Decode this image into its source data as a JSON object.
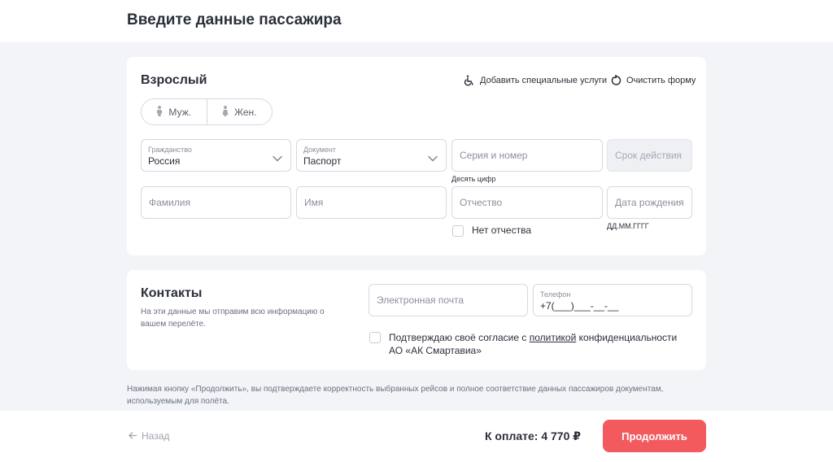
{
  "page": {
    "title": "Введите данные пассажира"
  },
  "adult": {
    "title": "Взрослый",
    "add_services": "Добавить специальные услуги",
    "clear_form": "Очистить форму",
    "gender": {
      "male": "Муж.",
      "female": "Жен."
    },
    "citizenship": {
      "label": "Гражданство",
      "value": "Россия"
    },
    "document": {
      "label": "Документ",
      "value": "Паспорт"
    },
    "series_number": {
      "placeholder": "Серия и номер",
      "hint": "Десять цифр"
    },
    "validity": {
      "placeholder": "Срок действия"
    },
    "last_name": {
      "placeholder": "Фамилия"
    },
    "first_name": {
      "placeholder": "Имя"
    },
    "patronymic": {
      "placeholder": "Отчество"
    },
    "birth_date": {
      "placeholder": "Дата рождения",
      "hint": "ДД.ММ.ГГГГ"
    },
    "no_patronymic": "Нет отчества"
  },
  "contacts": {
    "title": "Контакты",
    "description": "На эти данные мы отправим всю информацию о вашем перелёте.",
    "email": {
      "placeholder": "Электронная почта"
    },
    "phone": {
      "label": "Телефон",
      "value": "+7(___)___-__-__"
    },
    "consent_prefix": "Подтверждаю своё согласие с ",
    "consent_link": "политикой",
    "consent_suffix": " конфиденциальности АО «АК Смартавиа»"
  },
  "disclaimer": "Нажимая кнопку «Продолжить», вы подтверждаете корректность выбранных рейсов и полное соответствие данных пассажиров документам, используемым для полёта.",
  "footer": {
    "back": "Назад",
    "total": "К оплате: 4 770 ₽",
    "continue": "Продолжить"
  },
  "colors": {
    "accent": "#f25a5d",
    "background": "#f3f4f8",
    "text": "#2b2f3a",
    "muted": "#8a8f9c"
  }
}
